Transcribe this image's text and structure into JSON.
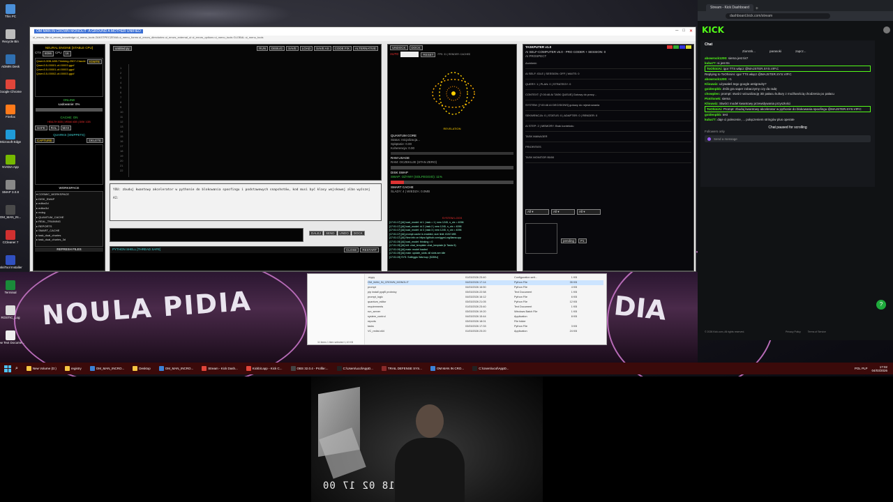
{
  "app": {
    "title": "OM MAN IN CROWN MONOLIT :A GROUND A MOTHER UNIFIED",
    "menu": "ui_errors_file   ui_errors_knowledge   ui_menu_tools   ZAKSTPECZENIA   ui_menu_forms   ui_errors_directories   ui_errors_external_ui   ui_errors_options   ui_menu_tools   GLOBAL   ui_menu_tools"
  },
  "left_panel": {
    "title": "NEURAL ENGINE [STABLE CPU]",
    "ctx_label": "CTX",
    "ctx_value": "8096",
    "cpu_label": "CPU",
    "cpu_value": "16",
    "ignite": "IGNITE",
    "models": [
      "Qwen3-30B-A3B-Thinking-2507-Claude",
      "Qwen3.5-00001-of-00003.gguf",
      "Qwen3.5-00001-of-00003.gguf",
      "Qwen3.5-00002-of-00003.gguf"
    ],
    "status": "ONLINE",
    "loading": "Ładowanie: 0%",
    "cache": "CACHE: ON",
    "cache_line": "HEALTH 8GB | VRAM 4GB | DISK 1GB",
    "safe_tags": [
      "SAFE",
      "RAL",
      "MAX"
    ],
    "quarks": "QUARKS (SNIPPETS)",
    "capture": "CAPTURE",
    "delete": "DELETE",
    "workspace": "WORKSPACE",
    "tree": [
      "COSMIC_WORKSPACE",
      "DISK_SWAP",
      "editor2d",
      "editor3d",
      "mdzg",
      "QUANTUM_CACHE",
      "REAL_TRAINING",
      "REPORTS",
      "SMART_CACHE",
      "task_dual_churies",
      "task_dual_churies_3d"
    ],
    "refresh": "REFRESH FILES"
  },
  "editor": {
    "tab": "untitled.py",
    "toolbar": [
      "RUN",
      "DEBUG",
      "SAVE",
      "LOAD",
      "SAVE AS",
      "CODE FIX",
      "ALTERNATIVE"
    ],
    "line_numbers": [
      "1",
      "2",
      "3",
      "4",
      "5",
      "6",
      "7",
      "8",
      "9",
      "10",
      "11",
      "12",
      "13",
      "14",
      "15",
      "16",
      "17",
      "18",
      "19",
      "20",
      "21",
      "22"
    ],
    "prompt_text": "YOU: zbuduj kwantowy akcelerator w pythonie do blokowania spoofingu i podstawowych snapshotów, kod musi być klasy wojskowej albo wyższej",
    "prompt_tail": "AI:",
    "send_buttons": [
      "DALEJ",
      "SEND",
      "UNDO",
      "DOCK"
    ],
    "shell_bar": "PYTHON SHELL [THREAD SAFE]",
    "shell_buttons": [
      "CLOSE",
      "RESTART"
    ]
  },
  "quantum": {
    "tabs": [
      "UNDOCK",
      "DOCK"
    ],
    "mode": "AUTO",
    "reset": "RESET",
    "fps": "FPS: 31 | RENDER: CACHED",
    "revelation": "REVELATION",
    "core_title": "QUANTUM CORE",
    "core_lines": [
      "Status: Inicjalizacja...",
      "Splątanie: 0.00",
      "Koherencja: 0.00"
    ],
    "ram_title": "RAM USAGE",
    "ram_line": "RAM: OCZEKUJE (STAN ZERO)",
    "disk_title": "DISK SWAP",
    "disk_line": "SWAP: OŻYWY (SOLFEGGIO): 11%",
    "cache_title": "SMART CACHE",
    "cache_line": "ŚLADY: 4 | WIEDZA: 0.0MB",
    "logs_title": "SYSTEM LOGS",
    "logs": [
      "[17:01:17] [AI] load_model: id 1 | task = 1 | new 1245, n_ctx = 4096",
      "[17:01:17] [AI] load_model: id 2 | task 2 | new 1245, n_ctx = 4096",
      "[17:01:17] [AI] load_model: id 3 | task 3 | new 1245, n_ctx = 4096",
      "[17:01:17] [AI] prompt cache is enabled, size limit: 8192 MiB",
      "[17:01:17] [AI] New info on https://github.com/ggml-org/llama.cpp",
      "[17:01:19] [AI] load_model: thinking = 0",
      "[17:01:19] [AI] init: chat_template: chat_template (b Tasks 5)",
      "[17:01:19] [AI] main: model loaded",
      "[17:01:19] [AI] main: update_slots: all slots are idle",
      "[17:01:19] SYS: Solfeggio Warmup: [528Hz]"
    ]
  },
  "taskputer": {
    "title": "TASKPUTER v1.0",
    "subtitle": "AI SELF-COMPUTER v5.0 - PRO CODER + SESSION: 0",
    "header": "AI PROSPECT",
    "lines": [
      "Architekt:",
      "AI SELF: IDLE | SESSION: OFF | WAITS: 0",
      "QUERY: 1 | PLAN: 0 | STRATEGY: 0",
      "CONTEXT: [7:00:46 AI TASK QUEUE] Gotowy do pracy...",
      "SYSTEM: [7:00:46 AI DECISIONS] gotowy do rejestrowania",
      "SEKWENCJA: 0 | STATUS: 0 | ADAPTER: 0 | RENDER: 0",
      "AI STEP: 2 | MEMORY: Brak kontekstu",
      "TASK MANAGER",
      "PRIORITIES",
      "TASK MONITOR 95/00"
    ],
    "dropdowns": [
      "All",
      "All",
      "All"
    ],
    "filter_value": "pending",
    "priority_value": "P1"
  },
  "explorer": {
    "status": "11 items   1 item selected 1,10 KB",
    "files": [
      {
        "name": ".mypy",
        "date": "01/03/2026 23:40",
        "type": "Configuration sett...",
        "size": "1 KB"
      },
      {
        "name": "OM_MAN_IN_CROWN_MONOLIT",
        "date": "04/03/2026 17:14",
        "type": "Python File",
        "size": "35 KB"
      },
      {
        "name": "prompt",
        "date": "04/03/2026 16:50",
        "type": "Python File",
        "size": "4 KB"
      },
      {
        "name": "pip install pyqt5 probnicy",
        "date": "03/03/2026 22:58",
        "type": "Text Document",
        "size": "1 KB"
      },
      {
        "name": "prompt_logic",
        "date": "04/03/2026 16:12",
        "type": "Python File",
        "size": "6 KB"
      },
      {
        "name": "quantum_editor",
        "date": "03/03/2026 21:05",
        "type": "Python File",
        "size": "12 KB"
      },
      {
        "name": "requirements",
        "date": "01/03/2026 23:40",
        "type": "Text Document",
        "size": "1 KB"
      },
      {
        "name": "run_server",
        "date": "03/03/2026 19:20",
        "type": "Windows Batch File",
        "size": "1 KB"
      },
      {
        "name": "system_control",
        "date": "04/03/2026 15:44",
        "type": "Application",
        "size": "8 KB"
      },
      {
        "name": "reports",
        "date": "03/03/2026 18:01",
        "type": "File folder",
        "size": ""
      },
      {
        "name": "tasks",
        "date": "03/03/2026 17:33",
        "type": "Python File",
        "size": "3 KB"
      },
      {
        "name": "VC_redist.x64",
        "date": "01/03/2026 23:20",
        "type": "Application",
        "size": "24 KB"
      }
    ]
  },
  "browser": {
    "tab": "Stream - Kick Dashboard",
    "url": "dashboard.kick.com/stream",
    "logo": "KICK",
    "chat_title": "Chat",
    "chat_tabs": [
      "ZiomSk...",
      "parasoki",
      "zapcz..."
    ],
    "messages": [
      {
        "user": "abowrock1200:",
        "text": "siema jest tis?"
      },
      {
        "user": "kuba77:",
        "text": "si jest tts"
      },
      {
        "user": "ToOhiniAi:",
        "text": "igor TTS włącz @MAJSTER.SYS.VIP.C",
        "highlight": true
      },
      {
        "user": "",
        "text": "Replying to ToOhiniAi: igor TTS włącz @MAJSTER.SYS.VIP.C"
      },
      {
        "user": "abowrock1200:",
        "text": "+1"
      },
      {
        "user": "Kliouwiz:",
        "text": "używałeś tego google antigravity?"
      },
      {
        "user": "goidenpbb:",
        "text": "Zrób gra saper zobaczymy czy da radę"
      },
      {
        "user": "chowplen:",
        "text": "prompt: stwórz wizualizację 3D pałacu kultury z możliwością chodzenia po pałacu"
      },
      {
        "user": "Piotrlonek:",
        "text": "siema"
      },
      {
        "user": "Kliouwiz:",
        "text": "Stwórz model kwantowy przewidywania przyszłości"
      },
      {
        "user": "ToOhiniAi:",
        "text": "Prompt: zbuduj kwantowy akcelerator w pythonie do blokowania spoofingu @MAJSTER.SYS.VIP.C",
        "highlight": true
      },
      {
        "user": "goidenpbb:",
        "text": "test"
      },
      {
        "user": "kuba77:",
        "text": "daje ci polecenie, ... połączeniem stringów plus operate"
      }
    ],
    "paused": "Chat paused for scrolling",
    "followers": "Followers only",
    "send_placeholder": "Send a message",
    "footer": "© 2026 Kick.com, All rights reserved.",
    "footer_links": [
      "Privacy Policy",
      "Terms of Service"
    ]
  },
  "desktop": {
    "wallpaper_text": "NOULA PIDIA",
    "icons": [
      {
        "label": "This PC",
        "color": "#4a8fd8"
      },
      {
        "label": "Recycle Bin",
        "color": "#bcbcbc"
      },
      {
        "label": "ADMIN Desk",
        "color": "#2f6fb0"
      },
      {
        "label": "Google Chrome",
        "color": "#e0453a"
      },
      {
        "label": "Firefox",
        "color": "#ff7a1a"
      },
      {
        "label": "Microsoft Edge",
        "color": "#1f9bd8"
      },
      {
        "label": "NVIDIA App",
        "color": "#76b900"
      },
      {
        "label": "SMAP 3.0.8",
        "color": "#888"
      },
      {
        "label": "OM_MAN_IN...",
        "color": "#4a4a4a"
      },
      {
        "label": "CCleaner 7",
        "color": "#cf3030"
      },
      {
        "label": "MiniTool Installer",
        "color": "#3050c0"
      },
      {
        "label": "Terminal",
        "color": "#1a8a3a"
      },
      {
        "label": "ROSTIC_Log",
        "color": "#ddd"
      },
      {
        "label": "New Text Docume...",
        "color": "#eee"
      }
    ]
  },
  "taskbar": {
    "items": [
      {
        "label": "New Volume (D:)",
        "color": "#f5c542"
      },
      {
        "label": "registry",
        "color": "#f5c542"
      },
      {
        "label": "OM_MAN_INCRO...",
        "color": "#3b82d6"
      },
      {
        "label": "Desktop",
        "color": "#f5c542"
      },
      {
        "label": "OM_MAN_INCRO...",
        "color": "#3b82d6"
      },
      {
        "label": "Stream - Kick Dash...",
        "color": "#e0453a"
      },
      {
        "label": "Kickbit.app - Kick C...",
        "color": "#e0453a"
      },
      {
        "label": "OBS 32.0.4 - Profile:...",
        "color": "#444"
      },
      {
        "label": "C:\\Users\\ucol\\AppD...",
        "color": "#222"
      },
      {
        "label": "TRAIL DEFENSE SYS...",
        "color": "#8a2a2a"
      },
      {
        "label": "OM MAN IN CRO...",
        "color": "#3b82d6"
      },
      {
        "label": "C:\\Users\\ucol\\AppD...",
        "color": "#222"
      }
    ],
    "lang": "POL PLP",
    "time": "17:02",
    "date": "04/03/2026"
  },
  "webcam": {
    "clock": "18 02 17 00"
  }
}
